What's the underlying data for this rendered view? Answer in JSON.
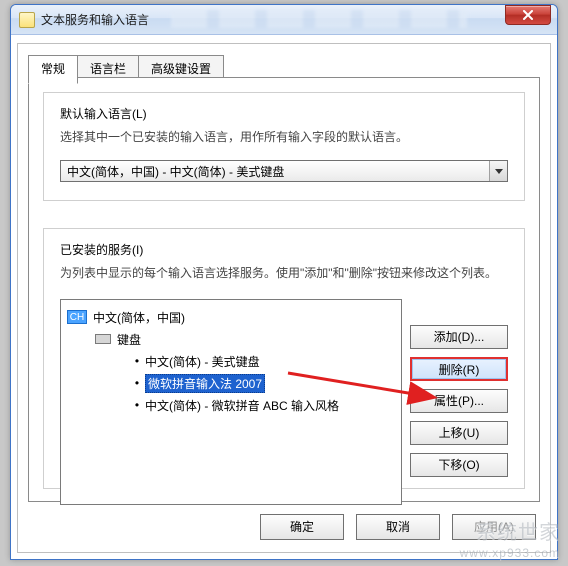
{
  "window": {
    "title": "文本服务和输入语言"
  },
  "tabs": {
    "general": "常规",
    "langbar": "语言栏",
    "advanced": "高级键设置"
  },
  "defaultGroup": {
    "heading": "默认输入语言(L)",
    "desc": "选择其中一个已安装的输入语言，用作所有输入字段的默认语言。",
    "comboValue": "中文(简体，中国) - 中文(简体) - 美式键盘"
  },
  "servicesGroup": {
    "heading": "已安装的服务(I)",
    "desc": "为列表中显示的每个输入语言选择服务。使用\"添加\"和\"删除\"按钮来修改这个列表。"
  },
  "tree": {
    "langBadge": "CH",
    "langLabel": "中文(简体，中国)",
    "kbLabel": "键盘",
    "item1": "中文(简体) - 美式键盘",
    "item2": "微软拼音输入法 2007",
    "item3": "中文(简体) - 微软拼音 ABC 输入风格"
  },
  "sideButtons": {
    "add": "添加(D)...",
    "remove": "删除(R)",
    "props": "属性(P)...",
    "moveUp": "上移(U)",
    "moveDown": "下移(O)"
  },
  "dialogButtons": {
    "ok": "确定",
    "cancel": "取消",
    "apply": "应用(A)"
  },
  "watermark": {
    "line1": "系统世家",
    "line2": "www.xp933.com"
  }
}
